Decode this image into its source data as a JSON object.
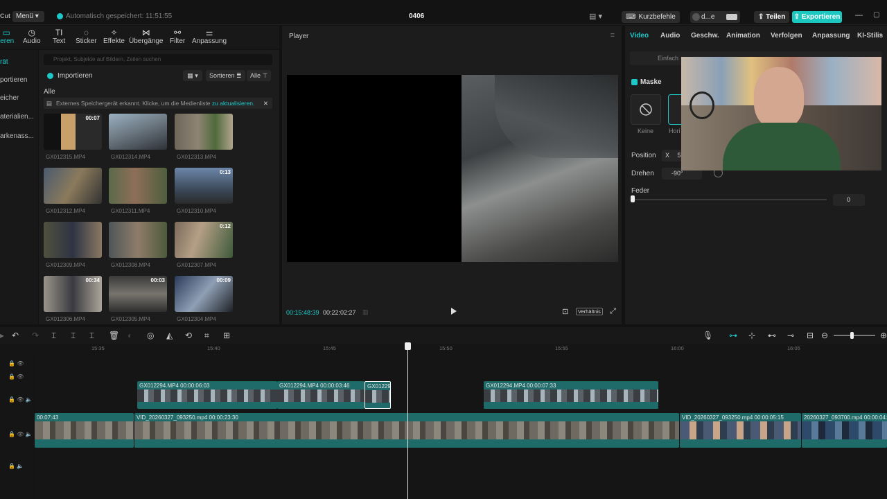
{
  "topbar": {
    "cut_label": "Cut",
    "menu_label": "Menü ▾",
    "autosave_text": "Automatisch gespeichert: 11:51:55",
    "project_name": "0406",
    "shortcuts_label": "Kurzbefehle",
    "user_label": "d...e",
    "share_label": "Teilen",
    "export_label": "Exportieren"
  },
  "tools": [
    {
      "label": "ieren",
      "icon": "import-icon"
    },
    {
      "label": "Audio",
      "icon": "audio-icon"
    },
    {
      "label": "Text",
      "icon": "text-icon"
    },
    {
      "label": "Sticker",
      "icon": "sticker-icon"
    },
    {
      "label": "Effekte",
      "icon": "effects-icon"
    },
    {
      "label": "Übergänge",
      "icon": "transitions-icon"
    },
    {
      "label": "Filter",
      "icon": "filter-icon"
    },
    {
      "label": "Anpassung",
      "icon": "adjust-icon"
    }
  ],
  "leftnav": [
    "rät",
    "portieren",
    "eicher",
    "aterialien...",
    "arkenass..."
  ],
  "media": {
    "search_placeholder": "Projekt, Subjekte auf Bildern, Zeilen suchen",
    "import_label": "Importieren",
    "sort_label": "Sortieren",
    "all_btn_label": "Alle",
    "all_label": "Alle",
    "notice_text": "Externes Speichergerät erkannt. Klicke, um die Medienliste",
    "notice_link": "zu aktualisieren.",
    "items": [
      {
        "name": "GX012315.MP4",
        "duration": "00:07"
      },
      {
        "name": "GX012314.MP4",
        "duration": ""
      },
      {
        "name": "GX012313.MP4",
        "duration": ""
      },
      {
        "name": "GX012312.MP4",
        "duration": ""
      },
      {
        "name": "GX012311.MP4",
        "duration": ""
      },
      {
        "name": "GX012310.MP4",
        "duration": "0:13"
      },
      {
        "name": "GX012309.MP4",
        "duration": ""
      },
      {
        "name": "GX012308.MP4",
        "duration": ""
      },
      {
        "name": "GX012307.MP4",
        "duration": "0:12"
      },
      {
        "name": "GX012306.MP4",
        "duration": "00:34"
      },
      {
        "name": "GX012305.MP4",
        "duration": "00:03"
      },
      {
        "name": "GX012304.MP4",
        "duration": "00:09"
      }
    ]
  },
  "player": {
    "title": "Player",
    "current_time": "00:15:48:39",
    "total_time": "00:22:02:27",
    "ratio_label": "Verhältnis"
  },
  "inspector": {
    "tabs": [
      "Video",
      "Audio",
      "Geschw.",
      "Animation",
      "Verfolgen",
      "Anpassung",
      "KI-Stilis"
    ],
    "subtab": "Einfach",
    "mask_label": "Maske",
    "mask_none": "Keine",
    "mask_horizontal": "Hori",
    "position_label": "Position",
    "position_x_label": "X",
    "position_x_value": "5",
    "rotate_label": "Drehen",
    "rotate_value": "-90°",
    "feather_label": "Feder",
    "feather_value": "0"
  },
  "timeline": {
    "ruler": [
      "15:35",
      "15:40",
      "15:45",
      "15:50",
      "15:55",
      "16:00",
      "16:05"
    ],
    "overlay_clips": [
      {
        "label": "GX012294.MP4  00:00:06:03"
      },
      {
        "label": "GX012294.MP4  00:00:03:46"
      },
      {
        "label": "GX01229"
      },
      {
        "label": "GX012294.MP4  00:00:07:33"
      }
    ],
    "main_clips": [
      {
        "label": "00:07:43"
      },
      {
        "label": "VID_20260327_093250.mp4  00:00:23:30"
      },
      {
        "label": "VID_20260327_093250.mp4  00:00:05:15"
      },
      {
        "label": "20260327_093700.mp4  00:00:04:2"
      }
    ]
  },
  "colors": {
    "accent": "#1fc8c8",
    "clip": "#1e6b69",
    "export": "#1cc7c0"
  }
}
